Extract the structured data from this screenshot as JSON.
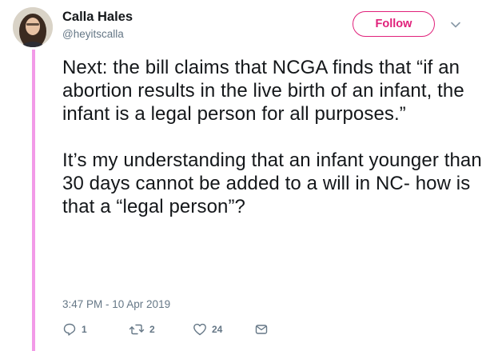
{
  "author": {
    "name": "Calla Hales",
    "handle": "@heyitscalla",
    "avatar_icon": "profile-photo"
  },
  "follow_button": {
    "label": "Follow",
    "color": "#e0207a"
  },
  "menu_icon": "chevron-down-icon",
  "tweet": {
    "paragraphs": [
      "Next: the bill claims that NCGA finds that “if an abortion results in the live birth of an infant, the infant is a legal person for all purposes.”",
      "It’s my understanding that an infant younger than 30 days cannot be added to a will in NC- how is that a “legal person”?"
    ],
    "timestamp": "3:47 PM - 10 Apr 2019"
  },
  "actions": {
    "reply_count": "1",
    "retweet_count": "2",
    "like_count": "24",
    "icons": [
      "reply-icon",
      "retweet-icon",
      "like-icon",
      "message-icon"
    ]
  },
  "thread_line_color": "#f29ae8"
}
